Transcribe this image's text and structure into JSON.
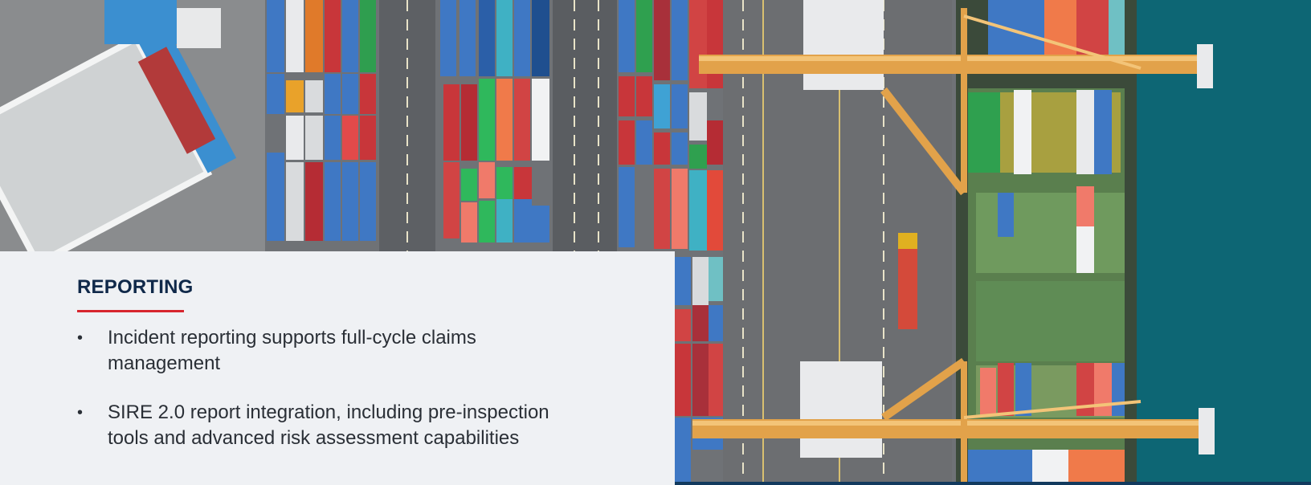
{
  "section": {
    "heading": "REPORTING",
    "bullets": [
      "Incident reporting supports full-cycle claims management",
      "SIRE 2.0 report integration, including pre-inspection tools and advanced risk assessment capabilities"
    ]
  },
  "colors": {
    "heading": "#10294a",
    "accent_rule": "#d7262e",
    "card_background": "#eff1f4",
    "sea": "#0f6a78"
  },
  "photo": {
    "icon": "aerial-container-port-image"
  }
}
